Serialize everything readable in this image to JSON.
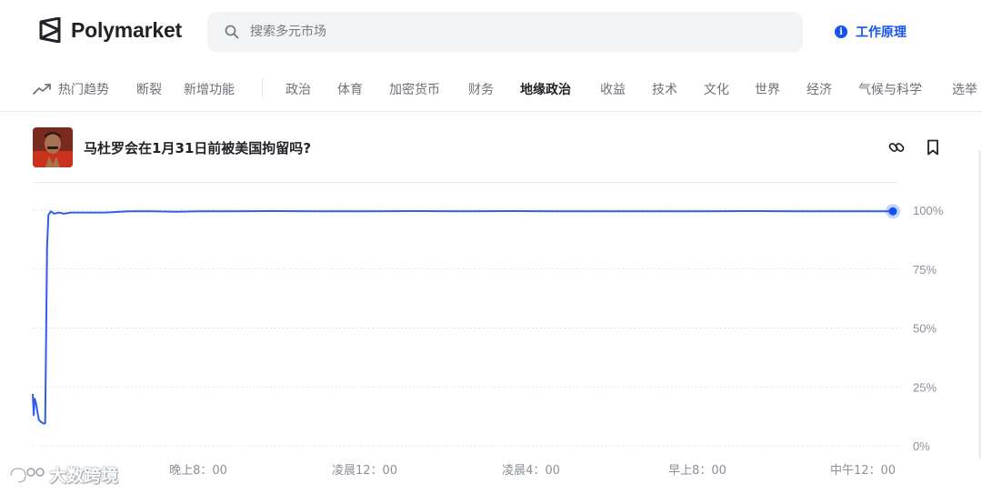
{
  "app": {
    "name": "Polymarket"
  },
  "search": {
    "placeholder": "搜索多元市场"
  },
  "header": {
    "how_it_works": "工作原理"
  },
  "nav": {
    "trending": "热门趋势",
    "items": [
      {
        "label": "断裂",
        "active": false
      },
      {
        "label": "新增功能",
        "active": false
      },
      {
        "label": "政治",
        "active": false
      },
      {
        "label": "体育",
        "active": false
      },
      {
        "label": "加密货币",
        "active": false
      },
      {
        "label": "财务",
        "active": false
      },
      {
        "label": "地缘政治",
        "active": true
      },
      {
        "label": "收益",
        "active": false
      },
      {
        "label": "技术",
        "active": false
      },
      {
        "label": "文化",
        "active": false
      },
      {
        "label": "世界",
        "active": false
      },
      {
        "label": "经济",
        "active": false
      },
      {
        "label": "气候与科学",
        "active": false
      },
      {
        "label": "选举",
        "active": false
      }
    ]
  },
  "market": {
    "title": "马杜罗会在1月31日前被美国拘留吗?",
    "avatar_icon": "market-avatar"
  },
  "colors": {
    "accent": "#1652f0",
    "line": "#2f5fe8",
    "grid": "#d7dbe0"
  },
  "chart_data": {
    "type": "line",
    "y_unit": "%",
    "ylim": [
      0,
      100
    ],
    "y_ticks": [
      {
        "value": 100,
        "label": "100%"
      },
      {
        "value": 75,
        "label": "75%"
      },
      {
        "value": 50,
        "label": "50%"
      },
      {
        "value": 25,
        "label": "25%"
      },
      {
        "value": 0,
        "label": "0%"
      }
    ],
    "x_ticks": [
      "晚上8：00",
      "凌晨12：00",
      "凌晨4：00",
      "早上8：00",
      "中午12：00"
    ],
    "grid": "horizontal dotted",
    "series": [
      {
        "values": [
          [
            0.0,
            22
          ],
          [
            0.02,
            13
          ],
          [
            0.04,
            20
          ],
          [
            0.07,
            18
          ],
          [
            0.1,
            14
          ],
          [
            0.13,
            11
          ],
          [
            0.18,
            10
          ],
          [
            0.22,
            9.5
          ],
          [
            0.26,
            9.5
          ],
          [
            0.3,
            85
          ],
          [
            0.33,
            98
          ],
          [
            0.38,
            99.5
          ],
          [
            0.45,
            98.5
          ],
          [
            0.55,
            99
          ],
          [
            0.65,
            98.5
          ],
          [
            0.8,
            99
          ],
          [
            1.0,
            99
          ],
          [
            1.5,
            99
          ],
          [
            2.0,
            99.5
          ],
          [
            2.5,
            99.5
          ],
          [
            3.0,
            99.3
          ],
          [
            3.5,
            99.5
          ],
          [
            4.0,
            99.5
          ],
          [
            5.0,
            99.6
          ],
          [
            6.0,
            99.5
          ],
          [
            7.0,
            99.5
          ],
          [
            8.0,
            99.6
          ],
          [
            9.0,
            99.5
          ],
          [
            10.0,
            99.6
          ],
          [
            11.0,
            99.5
          ],
          [
            12.0,
            99.5
          ],
          [
            13.0,
            99.5
          ],
          [
            14.0,
            99.5
          ],
          [
            15.0,
            99.6
          ],
          [
            16.0,
            99.5
          ],
          [
            17.0,
            99.5
          ],
          [
            18.0,
            99.5
          ]
        ]
      }
    ]
  },
  "watermark": {
    "text": "大数跨境"
  }
}
